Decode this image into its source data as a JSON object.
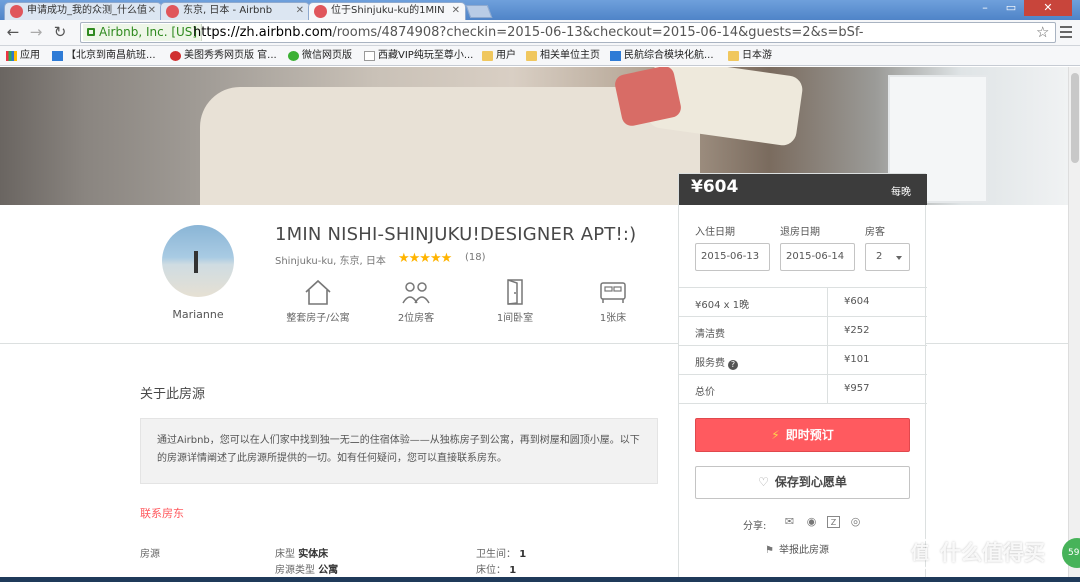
{
  "browser": {
    "tabs": [
      {
        "title": "申请成功_我的众测_什么值"
      },
      {
        "title": "东京, 日本 - Airbnb"
      },
      {
        "title": "位于Shinjuku-ku的1MIN"
      }
    ],
    "site_identity": "Airbnb, Inc. [US]",
    "url_host": "https://zh.airbnb.com",
    "url_rest": "/rooms/4874908?checkin=2015-06-13&checkout=2015-06-14&guests=2&s=bSf-",
    "bookmarks": [
      {
        "label": "应用",
        "icon": "grid"
      },
      {
        "label": "【北京到南昌航班...",
        "icon": "blue"
      },
      {
        "label": "美图秀秀网页版 官...",
        "icon": "red"
      },
      {
        "label": "微信网页版",
        "icon": "wechat"
      },
      {
        "label": "西藏VIP纯玩至尊小...",
        "icon": "page"
      },
      {
        "label": "用户",
        "icon": "folder"
      },
      {
        "label": "相关单位主页",
        "icon": "folder"
      },
      {
        "label": "民航综合模块化航...",
        "icon": "blue"
      },
      {
        "label": "日本游",
        "icon": "folder"
      }
    ]
  },
  "listing": {
    "title": "1MIN NISHI-SHINJUKU!DESIGNER APT!:)",
    "location": "Shinjuku-ku, 东京, 日本",
    "stars": "★★★★★",
    "rating": 4.5,
    "reviews": "(18)",
    "host_name": "Marianne",
    "amenities": [
      {
        "label": "整套房子/公寓",
        "icon": "house-icon"
      },
      {
        "label": "2位房客",
        "icon": "guests-icon"
      },
      {
        "label": "1间卧室",
        "icon": "door-icon"
      },
      {
        "label": "1张床",
        "icon": "bed-icon"
      }
    ]
  },
  "about": {
    "title": "关于此房源",
    "description": "通过Airbnb，您可以在人们家中找到独一无二的住宿体验——从独栋房子到公寓，再到树屋和圆顶小屋。以下的房源详情阐述了此房源所提供的一切。如有任何疑问，您可以直接联系房东。",
    "contact_host": "联系房东",
    "facts_label": "房源",
    "facts": [
      {
        "label": "床型",
        "value": "实体床"
      },
      {
        "label": "房源类型",
        "value": "公寓"
      },
      {
        "label": "卫生间：",
        "value": "1"
      },
      {
        "label": "床位：",
        "value": "1"
      }
    ]
  },
  "booking": {
    "price": "¥604",
    "per_night": "每晚",
    "checkin_label": "入住日期",
    "checkout_label": "退房日期",
    "guests_label": "房客",
    "checkin": "2015-06-13",
    "checkout": "2015-06-14",
    "guests": "2",
    "cost_rows": [
      {
        "label": "¥604 x 1晚",
        "value": "¥604"
      },
      {
        "label": "清洁费",
        "value": "¥252"
      },
      {
        "label": "服务费",
        "value": "¥101"
      },
      {
        "label": "总价",
        "value": "¥957"
      }
    ],
    "instant_book": "即时预订",
    "wishlist": "保存到心愿单",
    "share_label": "分享:",
    "report": "举报此房源"
  },
  "watermark": {
    "text": "什么值得买",
    "logo": "值"
  },
  "badge": "59",
  "colors": {
    "accent": "#ff5a5f",
    "price_bar": "#3c3c3c",
    "star": "#ffb400"
  }
}
